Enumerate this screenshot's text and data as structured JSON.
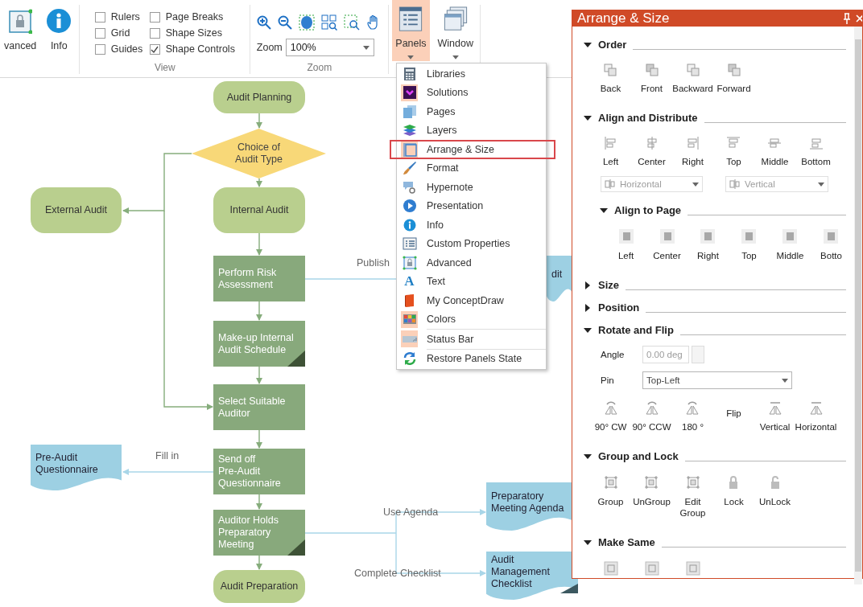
{
  "ribbon": {
    "buttons": [
      {
        "label": "vanced",
        "kind": "advanced"
      },
      {
        "label": "Info",
        "kind": "info"
      }
    ],
    "view": {
      "checkboxes": [
        {
          "label": "Rulers",
          "checked": false
        },
        {
          "label": "Page Breaks",
          "checked": false
        },
        {
          "label": "Grid",
          "checked": false
        },
        {
          "label": "Shape Sizes",
          "checked": false
        },
        {
          "label": "Guides",
          "checked": false
        },
        {
          "label": "Shape Controls",
          "checked": true
        }
      ],
      "group_label": "View"
    },
    "zoom": {
      "label": "Zoom",
      "value": "100%",
      "group_label": "Zoom"
    },
    "panels_button": {
      "label": "Panels",
      "selected": true
    },
    "window_button": {
      "label": "Window",
      "selected": false
    }
  },
  "panels_menu": {
    "groups": [
      [
        {
          "label": "Libraries",
          "checked": false,
          "outlined": false
        },
        {
          "label": "Solutions",
          "checked": true,
          "outlined": false
        },
        {
          "label": "Pages",
          "checked": false,
          "outlined": false
        },
        {
          "label": "Layers",
          "checked": false,
          "outlined": false
        },
        {
          "label": "Arrange & Size",
          "checked": true,
          "outlined": true
        },
        {
          "label": "Format",
          "checked": false,
          "outlined": false
        },
        {
          "label": "Hypernote",
          "checked": false,
          "outlined": false
        },
        {
          "label": "Presentation",
          "checked": false,
          "outlined": false
        },
        {
          "label": "Info",
          "checked": false,
          "outlined": false
        },
        {
          "label": "Custom Properties",
          "checked": false,
          "outlined": false
        },
        {
          "label": "Advanced",
          "checked": false,
          "outlined": false
        },
        {
          "label": "Text",
          "checked": false,
          "outlined": false,
          "glyph": "A"
        },
        {
          "label": "My ConceptDraw",
          "checked": false,
          "outlined": false
        },
        {
          "label": "Colors",
          "checked": true,
          "outlined": false
        }
      ],
      [
        {
          "label": "Status Bar",
          "checked": true,
          "outlined": false
        }
      ],
      [
        {
          "label": "Restore Panels State",
          "checked": false,
          "outlined": false
        }
      ]
    ]
  },
  "diagram": {
    "nodes": [
      {
        "kind": "terminal",
        "label": "Audit Planning",
        "corner": false
      },
      {
        "kind": "decision",
        "label": "Choice of\nAudit Type",
        "corner": false
      },
      {
        "kind": "terminal",
        "label": "External Audit",
        "corner": false
      },
      {
        "kind": "terminal",
        "label": "Internal Audit",
        "corner": false
      },
      {
        "kind": "process",
        "label": "Perform Risk\nAssessment",
        "corner": false
      },
      {
        "kind": "process",
        "label": "Make-up Internal\nAudit Schedule",
        "corner": true
      },
      {
        "kind": "process",
        "label": "Select Suitable\nAuditor",
        "corner": false
      },
      {
        "kind": "process",
        "label": "Send off\nPre-Audit\nQuestionnaire",
        "corner": false
      },
      {
        "kind": "process",
        "label": "Auditor Holds\nPreparatory\nMeeting",
        "corner": true
      },
      {
        "kind": "terminal",
        "label": "Audit Preparation",
        "corner": false
      },
      {
        "kind": "document",
        "label": "Pre-Audit\nQuestionnaire",
        "corner": false
      },
      {
        "kind": "document",
        "label": "dit",
        "corner": false
      },
      {
        "kind": "document",
        "label": "Preparatory\nMeeting Agenda",
        "corner": false
      },
      {
        "kind": "document",
        "label": "Audit\nManagement\nChecklist",
        "corner": true
      }
    ],
    "connector_labels": [
      "Publish",
      "Fill in",
      "Use Agenda",
      "Complete Checklist"
    ]
  },
  "arrange_panel": {
    "title": "Arrange & Size",
    "sections": [
      {
        "kind": "buttons",
        "title": "Order",
        "expanded": true,
        "items": [
          "Back",
          "Front",
          "Backward",
          "Forward"
        ]
      },
      {
        "kind": "align",
        "title": "Align and Distribute",
        "expanded": true,
        "items": [
          "Left",
          "Center",
          "Right",
          "Top",
          "Middle",
          "Bottom"
        ],
        "dropdowns": [
          {
            "value": "Horizontal",
            "disabled": true
          },
          {
            "value": "Vertical",
            "disabled": true
          }
        ],
        "subsection": {
          "title": "Align to Page",
          "expanded": true,
          "items": [
            "Left",
            "Center",
            "Right",
            "Top",
            "Middle",
            "Botto"
          ]
        }
      },
      {
        "kind": "buttons",
        "title": "Size",
        "expanded": false
      },
      {
        "kind": "buttons",
        "title": "Position",
        "expanded": false
      },
      {
        "kind": "rotate",
        "title": "Rotate and Flip",
        "expanded": true,
        "angle": {
          "label": "Angle",
          "value": "0.00 deg",
          "disabled": true
        },
        "pin": {
          "label": "Pin",
          "value": "Top-Left"
        },
        "items": [
          "90° CW",
          "90° CCW",
          "180 °"
        ],
        "flip_label": "Flip",
        "flip_items": [
          "Vertical",
          "Horizontal"
        ]
      },
      {
        "kind": "buttons",
        "title": "Group and Lock",
        "expanded": true,
        "items": [
          "Group",
          "UnGroup",
          "Edit Group",
          "Lock",
          "UnLock"
        ]
      },
      {
        "kind": "icons",
        "title": "Make Same",
        "expanded": true
      }
    ]
  }
}
